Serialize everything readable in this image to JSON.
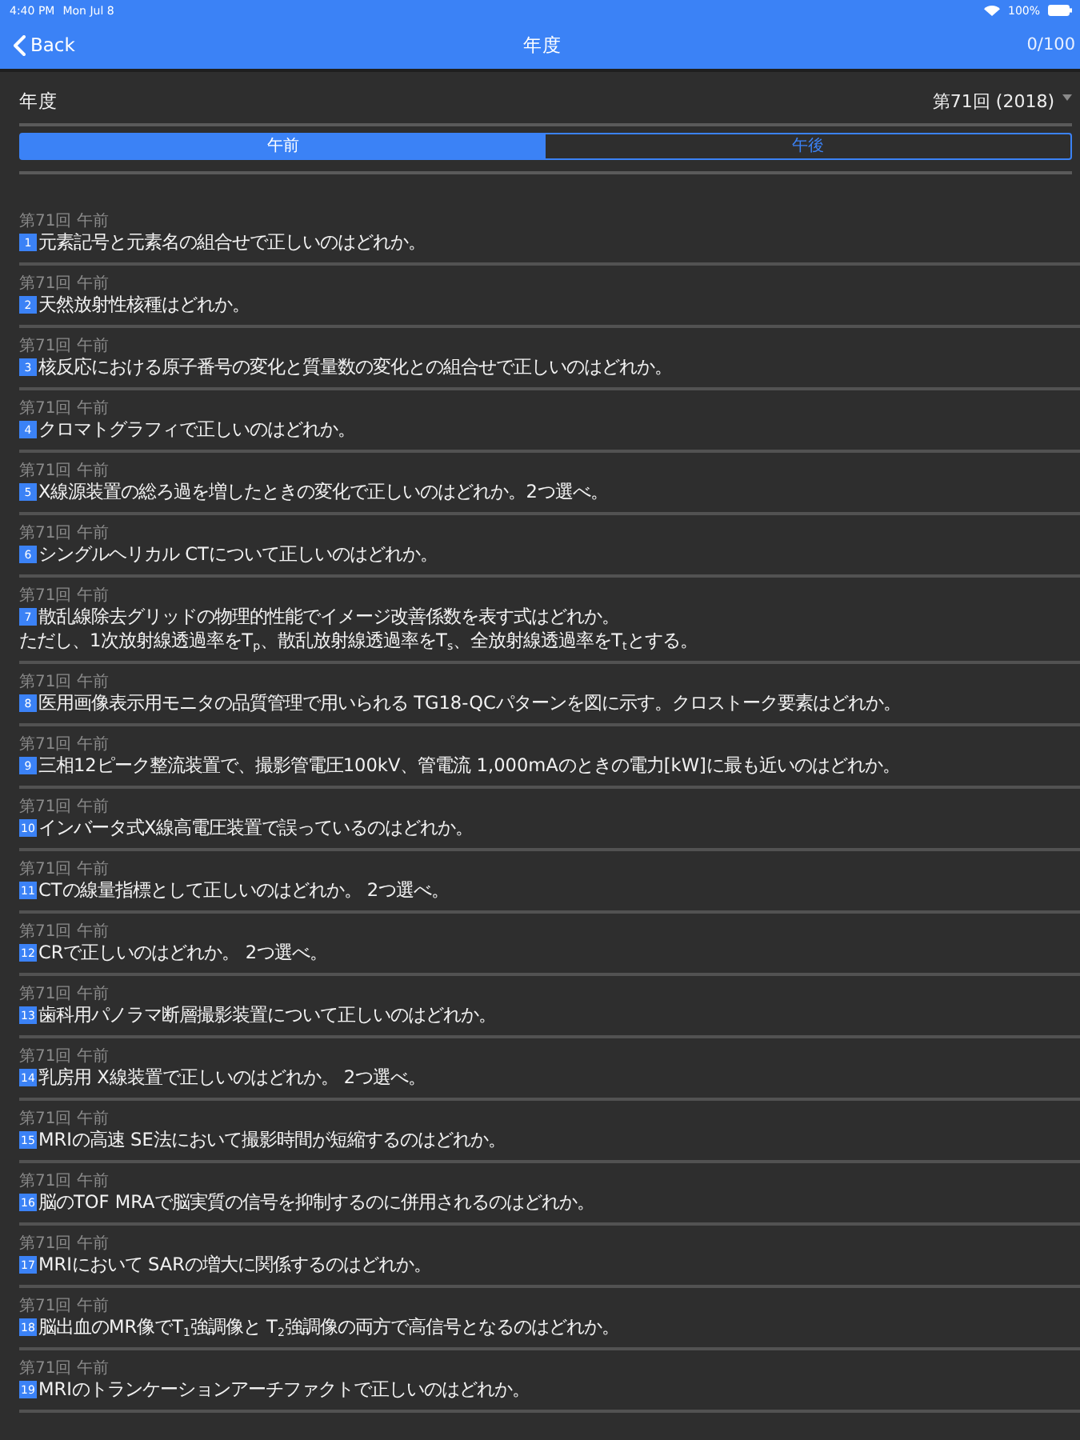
{
  "status_bar": {
    "time": "4:40 PM",
    "date": "Mon Jul 8",
    "battery": "100%"
  },
  "nav_bar": {
    "back": "Back",
    "title": "年度",
    "progress": "0/100"
  },
  "filter": {
    "label": "年度",
    "value": "第71回 (2018)"
  },
  "segments": [
    {
      "label": "午前",
      "selected": true
    },
    {
      "label": "午後",
      "selected": false
    }
  ],
  "questions": [
    {
      "meta": "第71回 午前",
      "number": "1",
      "text": "元素記号と元素名の組合せで正しいのはどれか。"
    },
    {
      "meta": "第71回 午前",
      "number": "2",
      "text": "天然放射性核種はどれか。"
    },
    {
      "meta": "第71回 午前",
      "number": "3",
      "text": "核反応における原子番号の変化と質量数の変化との組合せで正しいのはどれか。"
    },
    {
      "meta": "第71回 午前",
      "number": "4",
      "text": "クロマトグラフィで正しいのはどれか。"
    },
    {
      "meta": "第71回 午前",
      "number": "5",
      "text": "X線源装置の総ろ過を増したときの変化で正しいのはどれか。2つ選べ。"
    },
    {
      "meta": "第71回 午前",
      "number": "6",
      "text": "シングルヘリカル CTについて正しいのはどれか。"
    },
    {
      "meta": "第71回 午前",
      "number": "7",
      "text": "散乱線除去グリッドの物理的性能でイメージ改善係数を表す式はどれか。",
      "note": "ただし、1次放射線透過率をT$_{p}$、散乱放射線透過率をT$_{s}$、全放射線透過率をT$_{t}$とする。"
    },
    {
      "meta": "第71回 午前",
      "number": "8",
      "text": "医用画像表示用モニタの品質管理で用いられる TG18-QCパターンを図に示す。クロストーク要素はどれか。"
    },
    {
      "meta": "第71回 午前",
      "number": "9",
      "text": "三相12ピーク整流装置で、撮影管電圧100kV、管電流 1,000mAのときの電力[kW]に最も近いのはどれか。"
    },
    {
      "meta": "第71回 午前",
      "number": "10",
      "text": "インバータ式X線高電圧装置で誤っているのはどれか。"
    },
    {
      "meta": "第71回 午前",
      "number": "11",
      "text": "CTの線量指標として正しいのはどれか。 2つ選べ。"
    },
    {
      "meta": "第71回 午前",
      "number": "12",
      "text": "CRで正しいのはどれか。 2つ選べ。"
    },
    {
      "meta": "第71回 午前",
      "number": "13",
      "text": "歯科用パノラマ断層撮影装置について正しいのはどれか。"
    },
    {
      "meta": "第71回 午前",
      "number": "14",
      "text": "乳房用 X線装置で正しいのはどれか。 2つ選べ。"
    },
    {
      "meta": "第71回 午前",
      "number": "15",
      "text": "MRIの高速 SE法において撮影時間が短縮するのはどれか。"
    },
    {
      "meta": "第71回 午前",
      "number": "16",
      "text": "脳のTOF MRAで脳実質の信号を抑制するのに併用されるのはどれか。"
    },
    {
      "meta": "第71回 午前",
      "number": "17",
      "text": "MRIにおいて SARの増大に関係するのはどれか。"
    },
    {
      "meta": "第71回 午前",
      "number": "18",
      "text": "脳出血のMR像でT$_{1}$強調像と T$_{2}$強調像の両方で高信号となるのはどれか。"
    },
    {
      "meta": "第71回 午前",
      "number": "19",
      "text": "MRIのトランケーションアーチファクトで正しいのはどれか。"
    }
  ]
}
